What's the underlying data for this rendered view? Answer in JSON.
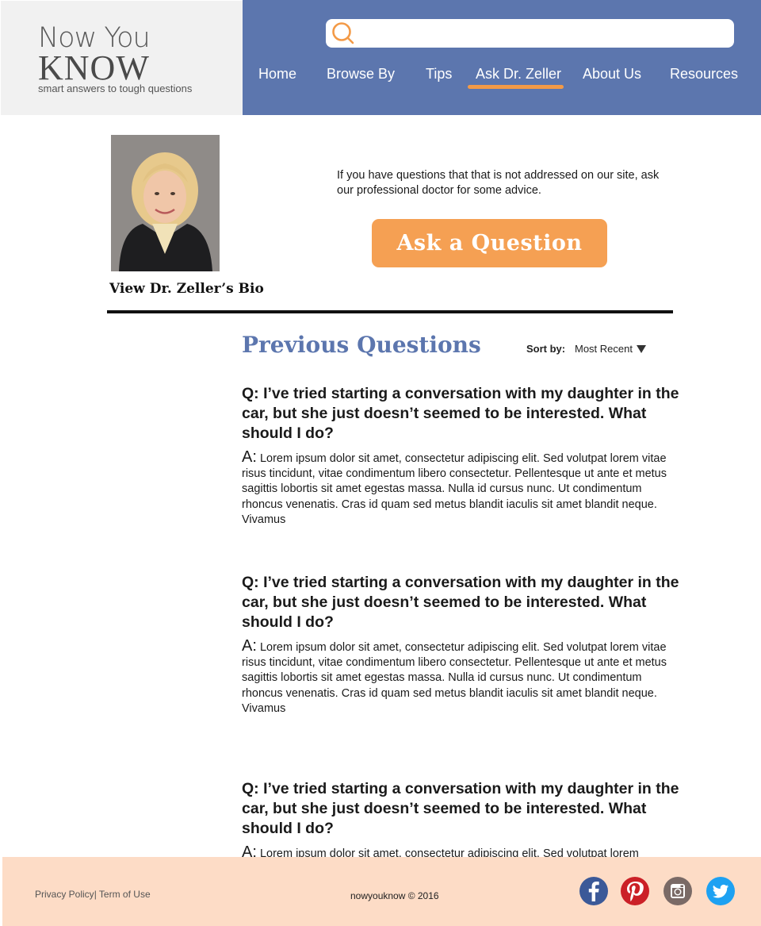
{
  "logo": {
    "line1": "Now You",
    "line2": "KNOW",
    "tagline": "smart answers to tough questions"
  },
  "search": {
    "placeholder": ""
  },
  "nav": {
    "items": [
      {
        "label": "Home"
      },
      {
        "label": "Browse By"
      },
      {
        "label": "Tips"
      },
      {
        "label": "Ask Dr. Zeller",
        "active": true
      },
      {
        "label": "About Us"
      },
      {
        "label": "Resources"
      }
    ]
  },
  "doctor": {
    "bio_link": "View Dr. Zeller’s Bio",
    "intro": "If you have questions that that is not addressed on our site, ask our professional doctor for some advice.",
    "ask_button": "Ask a Question"
  },
  "previous": {
    "title": "Previous Questions",
    "sort_label": "Sort by:",
    "sort_value": "Most Recent"
  },
  "questions": [
    {
      "q": "Q: I’ve tried starting a conversation with my daughter in the car, but she just doesn’t seemed to be interested. What should I do?",
      "a_prefix": "A:",
      "a": "Lorem ipsum dolor sit amet, consectetur adipiscing elit. Sed volutpat lorem vitae risus tincidunt, vitae condimentum libero consectetur. Pellentesque ut ante et metus sagittis lobortis sit amet egestas massa. Nulla id cursus nunc. Ut condimentum rhoncus venenatis. Cras id quam sed metus blandit iaculis sit amet blandit neque. Vivamus"
    },
    {
      "q": "Q: I’ve tried starting a conversation with my daughter in the car, but she just doesn’t seemed to be interested. What should I do?",
      "a_prefix": "A:",
      "a": "Lorem ipsum dolor sit amet, consectetur adipiscing elit. Sed volutpat lorem vitae risus tincidunt, vitae condimentum libero consectetur. Pellentesque ut ante et metus sagittis lobortis sit amet egestas massa. Nulla id cursus nunc. Ut condimentum rhoncus venenatis. Cras id quam sed metus blandit iaculis sit amet blandit neque. Vivamus"
    },
    {
      "q": "Q: I’ve tried starting a conversation with my daughter in the car, but she just doesn’t seemed to be interested. What should I do?",
      "a_prefix": "A:",
      "a": "Lorem ipsum dolor sit amet, consectetur adipiscing elit. Sed volutpat lorem"
    }
  ],
  "footer": {
    "privacy": "Privacy Policy",
    "separator": "|",
    "terms": " Term of Use",
    "copyright": "nowyouknow © 2016",
    "social": [
      "facebook-icon",
      "pinterest-icon",
      "instagram-icon",
      "twitter-icon"
    ]
  },
  "colors": {
    "nav_bg": "#5c76ae",
    "accent_orange": "#f5a053",
    "footer_bg": "#fddcc6",
    "title_blue": "#5c76ae"
  }
}
